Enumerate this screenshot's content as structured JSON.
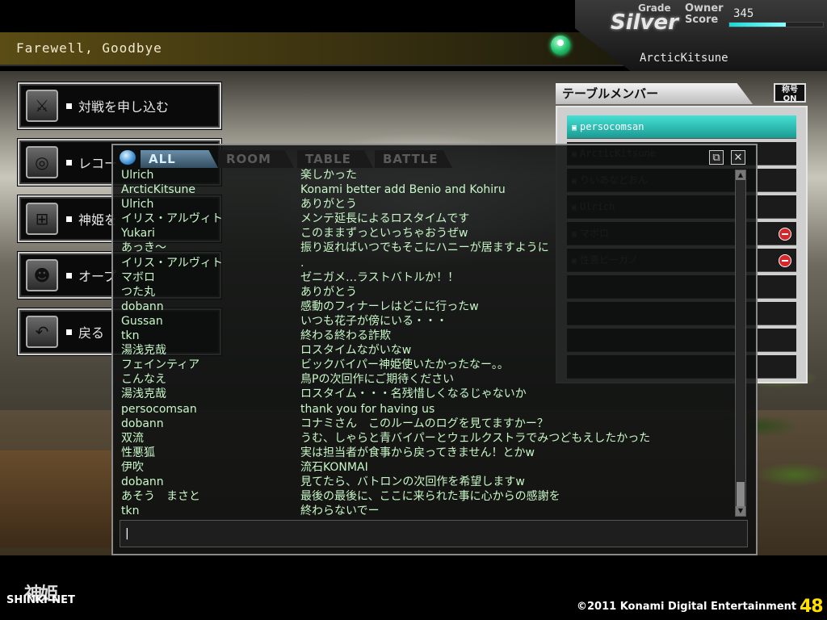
{
  "room": {
    "title": "Farewell, Goodbye"
  },
  "player": {
    "grade_label": "Grade",
    "grade": "Silver",
    "owner_label": "Owner",
    "score_label": "Score",
    "score": "345",
    "score_fill": 0.6,
    "name": "ArcticKitsune"
  },
  "menu": [
    {
      "label": "対戦を申し込む",
      "icon": "battle-request-icon"
    },
    {
      "label": "レコー",
      "icon": "record-icon"
    },
    {
      "label": "神姫を",
      "icon": "shinki-select-icon"
    },
    {
      "label": "オープ",
      "icon": "open-search-icon"
    },
    {
      "label": "戻る",
      "icon": "back-arrow-icon"
    }
  ],
  "members": {
    "header": "テーブルメンバー",
    "title_toggle": "称号\nON",
    "list": [
      {
        "name": "persocomsan",
        "active": true,
        "blocked": false
      },
      {
        "name": "ArcticKitsune",
        "active": false,
        "blocked": false
      },
      {
        "name": "りいあなどおん",
        "active": false,
        "blocked": false
      },
      {
        "name": "Ulrich",
        "active": false,
        "blocked": false
      },
      {
        "name": "マボロ",
        "active": false,
        "blocked": true
      },
      {
        "name": "性悪ピーガノ",
        "active": false,
        "blocked": true
      },
      {
        "name": "",
        "active": false,
        "blocked": false
      },
      {
        "name": "",
        "active": false,
        "blocked": false
      },
      {
        "name": "",
        "active": false,
        "blocked": false
      },
      {
        "name": "",
        "active": false,
        "blocked": false
      }
    ]
  },
  "chat": {
    "tabs": [
      "ALL",
      "ROOM",
      "TABLE",
      "BATTLE"
    ],
    "active_tab": "ALL",
    "input_value": "|",
    "messages": [
      {
        "name": "Ulrich",
        "text": "楽しかった"
      },
      {
        "name": "ArcticKitsune",
        "text": "Konami better add Benio and Kohiru"
      },
      {
        "name": "Ulrich",
        "text": "ありがとう"
      },
      {
        "name": "イリス・アルヴィト",
        "text": "メンテ延長によるロスタイムです"
      },
      {
        "name": "Yukari",
        "text": "このままずっといっちゃおうぜw"
      },
      {
        "name": "あっき〜",
        "text": "振り返ればいつでもそこにハニーが居ますように"
      },
      {
        "name": "イリス・アルヴィト",
        "text": "."
      },
      {
        "name": "マボロ",
        "text": "ゼニガメ…ラストバトルか！！"
      },
      {
        "name": "つた丸",
        "text": "ありがとう"
      },
      {
        "name": "dobann",
        "text": "感動のフィナーレはどこに行ったw"
      },
      {
        "name": "Gussan",
        "text": "いつも花子が傍にいる・・・"
      },
      {
        "name": "tkn",
        "text": "終わる終わる詐欺"
      },
      {
        "name": "湯浅克哉",
        "text": "ロスタイムながいなw"
      },
      {
        "name": "フェインティア",
        "text": "ビックバイパー神姫使いたかったなー。。"
      },
      {
        "name": "こんなえ",
        "text": "鳥Pの次回作にご期待ください"
      },
      {
        "name": "湯浅克哉",
        "text": "ロスタイム・・・名残惜しくなるじゃないか"
      },
      {
        "name": "persocomsan",
        "text": "thank you for having us"
      },
      {
        "name": "dobann",
        "text": "コナミさん　このルームのログを見てますかー？"
      },
      {
        "name": "双流",
        "text": "うむ、しゃらと青バイパーとウェルクストラでみつどもえしたかった"
      },
      {
        "name": "性悪狐",
        "text": "実は担当者が食事から戻ってきません！とかw"
      },
      {
        "name": "伊吹",
        "text": "流石KONMAI"
      },
      {
        "name": "dobann",
        "text": "見てたら、バトロンの次回作を希望しますw"
      },
      {
        "name": "あそう　まさと",
        "text": "最後の最後に、ここに来られた事に心からの感謝を"
      },
      {
        "name": "tkn",
        "text": "終わらないでー"
      }
    ]
  },
  "footer": {
    "logo_text": "SHINKI-NET",
    "copyright": "©2011 Konami Digital Entertainment",
    "rating": "48"
  },
  "colors": {
    "chat_text": "#c8f7c8",
    "active_member": "#47e0d4",
    "tab_active": "#6a8ea8",
    "status_online": "#1fbf6a"
  }
}
